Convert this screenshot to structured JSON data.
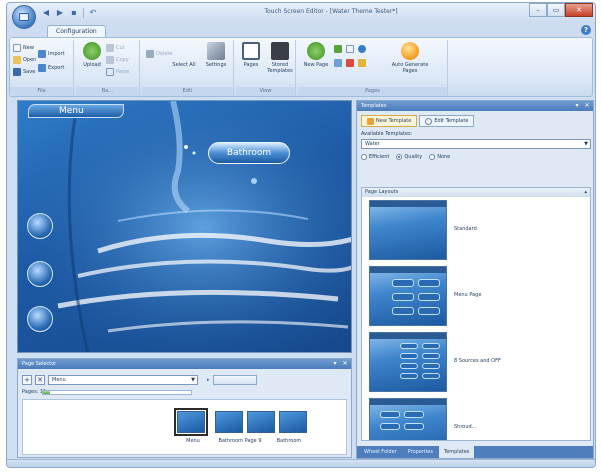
{
  "window": {
    "title": "Touch Screen Editor - [Water Theme Tester*]",
    "controls": {
      "minimize": "–",
      "maximize": "▭",
      "close": "✕"
    }
  },
  "qat": {
    "icons": [
      "back-icon",
      "forward-icon",
      "save-icon",
      "undo-icon"
    ]
  },
  "tabs": {
    "active": "Configuration",
    "help": "?"
  },
  "ribbon": {
    "groups": [
      {
        "label": "File"
      },
      {
        "label": "Ba..."
      },
      {
        "label": "Edit"
      },
      {
        "label": "View"
      },
      {
        "label": "Pages"
      }
    ],
    "file": {
      "new": "New",
      "open": "Open",
      "save": "Save",
      "import": "Import",
      "export": "Export",
      "upload": "Upload"
    },
    "edit": {
      "cut": "Cut",
      "copy": "Copy",
      "paste": "Paste",
      "delete": "Delete",
      "select_all": "Select All",
      "undo": "Undo"
    },
    "view": {
      "settings": "Settings",
      "pages": "Pages",
      "stored_templates": "Stored Templates"
    },
    "pages": {
      "new_page": "New Page",
      "auto_generate": "Auto Generate Pages"
    }
  },
  "canvas": {
    "menu_label": "Menu",
    "room_button": "Bathroom"
  },
  "page_selector": {
    "title": "Page Selector",
    "current_page": "Menu",
    "pages_label": "Pages: 11",
    "progress": 0.05,
    "thumbnails": [
      {
        "label": "Menu",
        "selected": true
      },
      {
        "label": "Bathroom Page 9",
        "selected": false
      },
      {
        "label": "",
        "selected": false
      },
      {
        "label": "Bathroom",
        "selected": false
      }
    ]
  },
  "template_panel": {
    "title": "Templates",
    "tabs": [
      "New Template",
      "Edit Template"
    ],
    "available_label": "Available Templates:",
    "selected_template": "Water",
    "radio_options": [
      {
        "label": "Efficient",
        "checked": false
      },
      {
        "label": "Quality",
        "checked": true
      },
      {
        "label": "None",
        "checked": false
      }
    ],
    "layouts_title": "Page Layouts",
    "layouts": [
      "Standard",
      "Menu Page",
      "8 Sources and OFF",
      "Shroud..."
    ],
    "bottom_tabs": [
      {
        "label": "Wheel Folder",
        "active": false
      },
      {
        "label": "Properties",
        "active": false
      },
      {
        "label": "Templates",
        "active": true
      }
    ]
  }
}
